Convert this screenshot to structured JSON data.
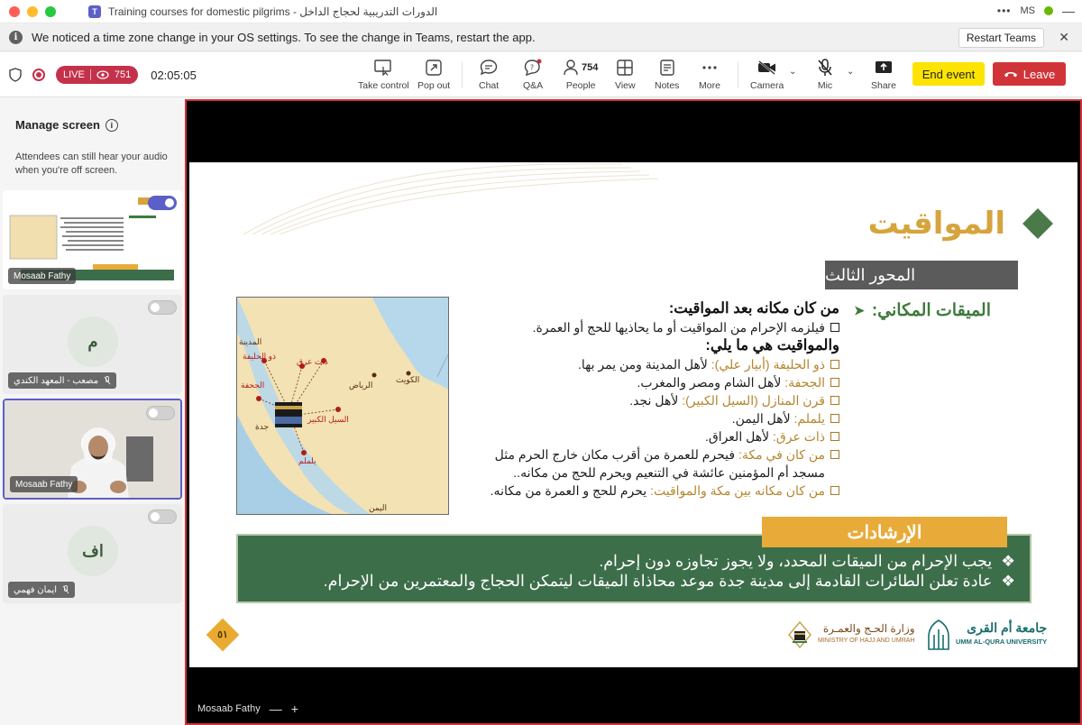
{
  "window": {
    "title": "Training courses for domestic pilgrims - الدورات التدريبية لحجاج الداخل",
    "user_initials": "MS",
    "menu_dots": "•••"
  },
  "notice": {
    "text": "We noticed a time zone change in your OS settings. To see the change in Teams, restart the app.",
    "restart_label": "Restart Teams",
    "info_glyph": "i",
    "close_glyph": "✕"
  },
  "toolbar": {
    "live_label": "LIVE",
    "viewers": "751",
    "timer": "02:05:05",
    "take_control": "Take control",
    "pop_out": "Pop out",
    "chat": "Chat",
    "qa": "Q&A",
    "people": "People",
    "people_count": "754",
    "view": "View",
    "notes": "Notes",
    "more": "More",
    "camera": "Camera",
    "mic": "Mic",
    "share": "Share",
    "end_event": "End event",
    "leave": "Leave"
  },
  "left_panel": {
    "title": "Manage screen",
    "subtitle": "Attendees can still hear your audio when you're off screen.",
    "tiles": [
      {
        "name": "Mosaab Fathy",
        "toggle": true
      },
      {
        "name": "مصعب - المعهد الكندي",
        "initials": "م",
        "toggle": false,
        "muted": true
      },
      {
        "name": "Mosaab Fathy",
        "toggle": false,
        "active": true
      },
      {
        "name": "ايمان فهمي",
        "initials": "اف",
        "toggle": false,
        "muted": true
      }
    ]
  },
  "slide": {
    "title": "المواقيت",
    "axis": "المحور الثالث",
    "miqat_label": "الميقات المكاني:",
    "heading1": "من كان مكانه بعد المواقيت:",
    "line1": "فيلزمه الإحرام من المواقيت أو ما يحاذيها للحج أو العمرة.",
    "heading2": "والمواقيت هي ما يلي:",
    "items": [
      {
        "gold": "ذو الحليفة (أبيار علي):",
        "text": " لأهل المدينة ومن يمر بها."
      },
      {
        "gold": "الجحفة:",
        "text": " لأهل الشام ومصر والمغرب."
      },
      {
        "gold": "قرن المنازل (السيل الكبير):",
        "text": " لأهل نجد."
      },
      {
        "gold": "يلملم:",
        "text": " لأهل اليمن."
      },
      {
        "gold": "ذات عرق:",
        "text": " لأهل العراق."
      },
      {
        "gold": "من كان في مكة:",
        "text": " فيحرم للعمرة من أقرب مكان خارج الحرم مثل مسجد أم المؤمنين عائشة في التنعيم ويحرم للحج من مكانه.."
      },
      {
        "gold": "من كان مكانه بين مكة والمواقيت:",
        "text": " يحرم للحج و العمرة من مكانه."
      }
    ],
    "guide_title": "الإرشادات",
    "guide_lines": [
      "يجب الإحرام من الميقات المحدد، ولا يجوز تجاوزه دون إحرام.",
      "عادة تعلن الطائرات القادمة إلى مدينة جدة موعد محاذاة الميقات ليتمكن الحجاج والمعتمرين من الإحرام."
    ],
    "page_number": "٥١",
    "hajj_logo_ar": "وزارة الحـج والعمـرة",
    "hajj_logo_en": "MINISTRY OF HAJJ AND UMRAH",
    "uqu_logo_ar": "جامعة أم القرى",
    "uqu_logo_en": "UMM AL-QURA UNIVERSITY",
    "map_labels": {
      "madinah": "المدينة",
      "dhul_hulayfah": "ذو الحليفة",
      "juhfah": "الجحفة",
      "dhat_irq": "ذات عرق",
      "riyadh": "الرياض",
      "kuwait": "الكويت",
      "sayl": "السيل الكبير",
      "jeddah": "جدة",
      "yalamlam": "يلملم",
      "yemen": "اليمن"
    }
  },
  "presenter": {
    "name": "Mosaab Fathy",
    "minus": "—",
    "plus": "+"
  },
  "colors": {
    "accent": "#5b5fc7",
    "live": "#c4314b",
    "end_event": "#fde300",
    "leave": "#d13438",
    "slide_gold": "#d6a43c",
    "slide_green": "#3d6e4a"
  }
}
